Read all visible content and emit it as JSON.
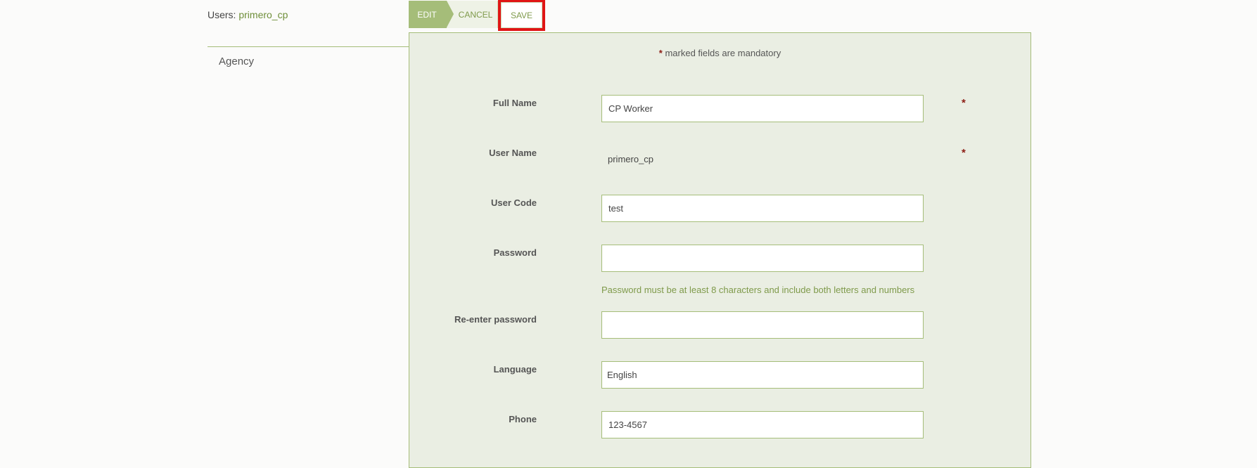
{
  "breadcrumb": {
    "prefix": "Users:",
    "current": "primero_cp"
  },
  "nav": {
    "items": [
      {
        "label": "Agency"
      }
    ]
  },
  "toolbar": {
    "edit_label": "EDIT",
    "cancel_label": "CANCEL",
    "save_label": "SAVE"
  },
  "form": {
    "mandatory_star": "*",
    "mandatory_note": " marked fields are mandatory",
    "fields": {
      "full_name": {
        "label": "Full Name",
        "value": "CP Worker",
        "required": "*"
      },
      "user_name": {
        "label": "User Name",
        "value": "primero_cp",
        "required": "*"
      },
      "user_code": {
        "label": "User Code",
        "value": "test"
      },
      "password": {
        "label": "Password",
        "value": "",
        "help": "Password must be at least 8 characters and include both letters and numbers"
      },
      "password_confirm": {
        "label": "Re-enter password",
        "value": ""
      },
      "language": {
        "label": "Language",
        "value": "English"
      },
      "phone": {
        "label": "Phone",
        "value": "123-4567"
      }
    }
  },
  "colors": {
    "accent": "#a5bd79",
    "link": "#6f8f3a",
    "panel_bg": "#eaeee3",
    "required": "#8c1c13",
    "highlight": "#e01515"
  }
}
